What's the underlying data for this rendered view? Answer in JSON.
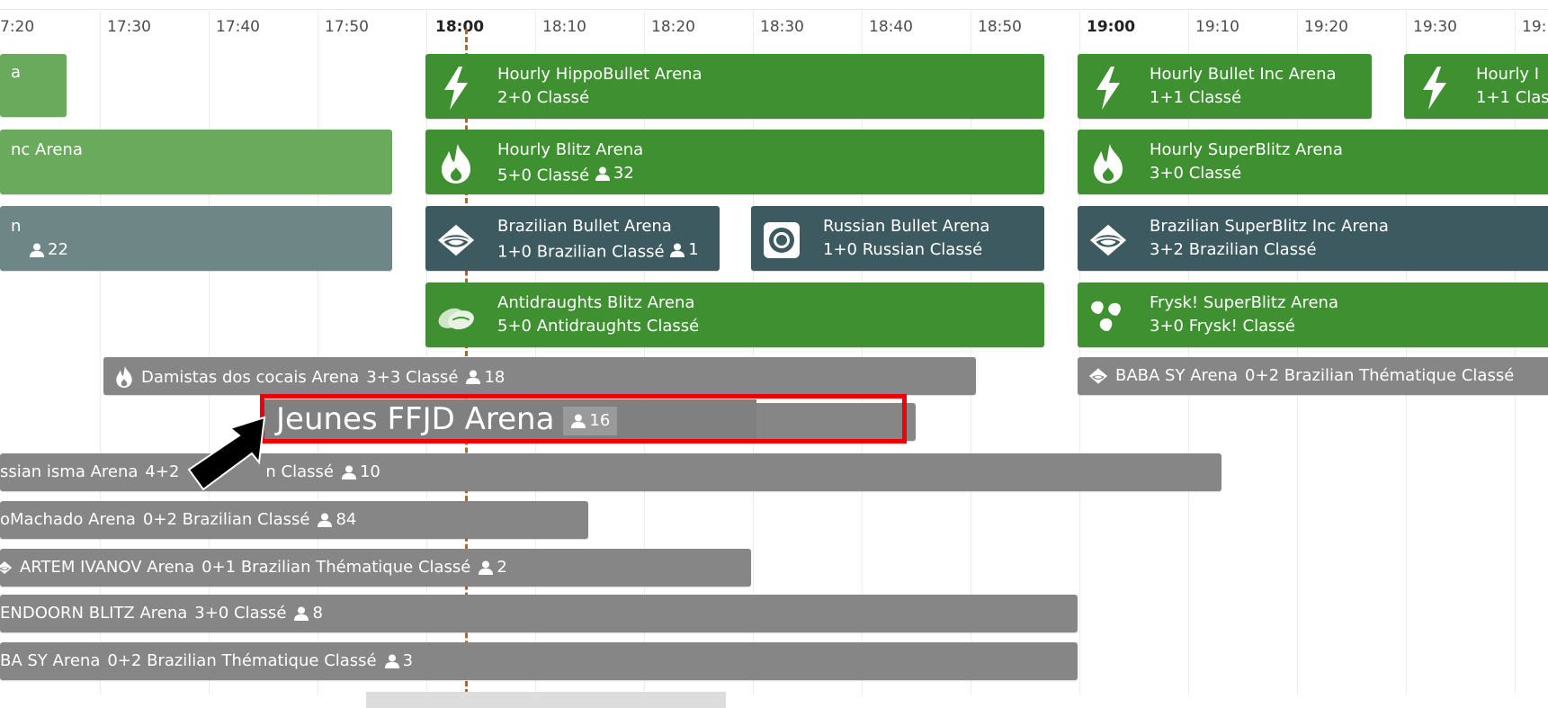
{
  "axis": {
    "ticks": [
      "7:20",
      "17:30",
      "17:40",
      "17:50",
      "18:00",
      "18:10",
      "18:20",
      "18:30",
      "18:40",
      "18:50",
      "19:00",
      "19:10",
      "19:20",
      "19:30",
      "19:"
    ],
    "hour_ticks": [
      "18:00",
      "19:00"
    ]
  },
  "row1": {
    "a": {
      "name": "a"
    },
    "hippo": {
      "name": "Hourly HippoBullet Arena",
      "info": "2+0 Classé",
      "icon": "lightning-icon"
    },
    "bullet_inc": {
      "name": "Hourly Bullet Inc Arena",
      "info": "1+1 Classé",
      "icon": "lightning-icon"
    },
    "hourly_cut": {
      "name": "Hourly I",
      "info": "1+1 Clas",
      "icon": "lightning-icon"
    }
  },
  "row2": {
    "inc": {
      "name": "nc Arena"
    },
    "blitz": {
      "name": "Hourly Blitz Arena",
      "info": "5+0 Classé",
      "players": "32",
      "icon": "flame-icon"
    },
    "superblitz": {
      "name": "Hourly SuperBlitz Arena",
      "info": "3+0 Classé",
      "icon": "flame-icon"
    }
  },
  "row3": {
    "partial": {
      "name": "n",
      "players": "22"
    },
    "brazilian_bullet": {
      "name": "Brazilian Bullet Arena",
      "info": "1+0 Brazilian Classé",
      "players": "1",
      "icon": "brazilian-eye-icon"
    },
    "russian_bullet": {
      "name": "Russian Bullet Arena",
      "info": "1+0 Russian Classé",
      "icon": "russian-target-icon"
    },
    "brazilian_superblitz": {
      "name": "Brazilian SuperBlitz Inc Arena",
      "info": "3+2 Brazilian Classé",
      "icon": "brazilian-eye-icon"
    }
  },
  "row4": {
    "antidraughts": {
      "name": "Antidraughts Blitz Arena",
      "info": "5+0 Antidraughts Classé",
      "icon": "antidraughts-icon"
    },
    "frysk": {
      "name": "Frysk! SuperBlitz Arena",
      "info": "3+0 Frysk! Classé",
      "icon": "frysk-icon"
    }
  },
  "row5": {
    "damistas": {
      "name": "Damistas dos cocais Arena",
      "info": "3+3 Classé",
      "players": "18",
      "icon": "flame-icon"
    },
    "baba_sy_top": {
      "name": "BABA SY Arena",
      "info": "0+2 Brazilian Thématique Classé",
      "icon": "brazilian-eye-icon"
    }
  },
  "highlight": {
    "name": "Jeunes FFJD Arena",
    "players": "16"
  },
  "row7": {
    "name": "ssian isma Arena",
    "info": "4+2",
    "info2": "n Classé",
    "players": "10"
  },
  "row8": {
    "name": "oMachado Arena",
    "info": "0+2 Brazilian Classé",
    "players": "84"
  },
  "row9": {
    "name": "ARTEM IVANOV Arena",
    "info": "0+1 Brazilian Thématique Classé",
    "players": "2",
    "icon": "brazilian-eye-icon"
  },
  "row10": {
    "name": "ENDOORN BLITZ Arena",
    "info": "3+0 Classé",
    "players": "8"
  },
  "row11": {
    "name": "BA SY Arena",
    "info": "0+2 Brazilian Thématique Classé",
    "players": "3"
  },
  "colors": {
    "green": "#3e9030",
    "light_green": "#6aaa5d",
    "teal": "#3c5a5f",
    "slate": "#6f8687",
    "gray": "#868686",
    "highlight_border": "#ee0000",
    "now_line": "#b8622a"
  }
}
